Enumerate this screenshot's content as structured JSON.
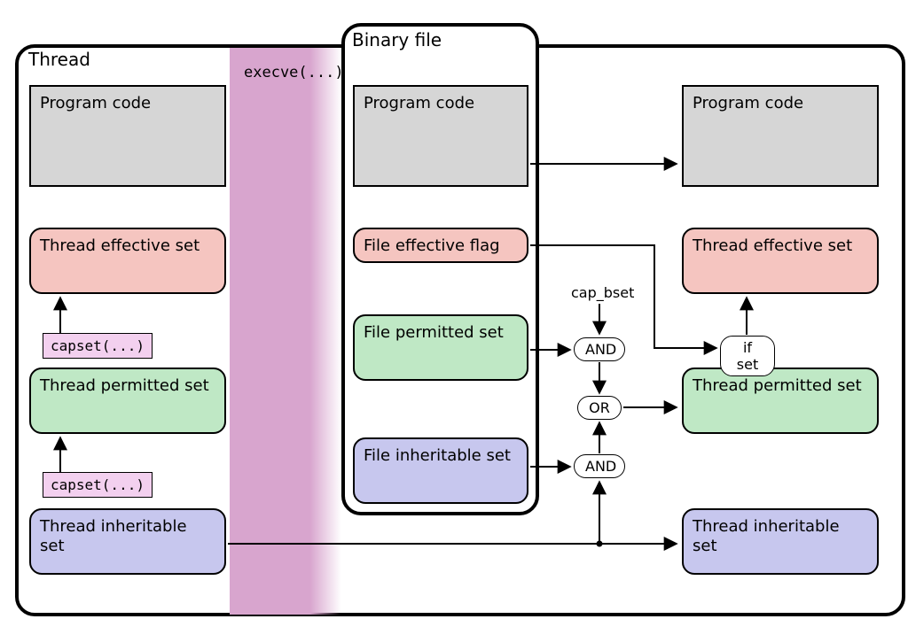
{
  "panels": {
    "thread": {
      "title": "Thread"
    },
    "binary": {
      "title": "Binary file"
    }
  },
  "thread_left": {
    "program_code": "Program code",
    "effective": "Thread effective set",
    "permitted": "Thread permitted set",
    "inheritable": "Thread inheritable set",
    "capset": "capset(...)"
  },
  "binary": {
    "program_code": "Program code",
    "effective_flag": "File effective flag",
    "permitted": "File permitted set",
    "inheritable": "File inheritable set"
  },
  "thread_right": {
    "program_code": "Program code",
    "effective": "Thread effective set",
    "permitted": "Thread permitted set",
    "inheritable": "Thread inheritable set"
  },
  "ops": {
    "and": "AND",
    "or": "OR",
    "if_set": "if set"
  },
  "labels": {
    "execve": "execve(...)",
    "cap_bset": "cap_bset"
  }
}
